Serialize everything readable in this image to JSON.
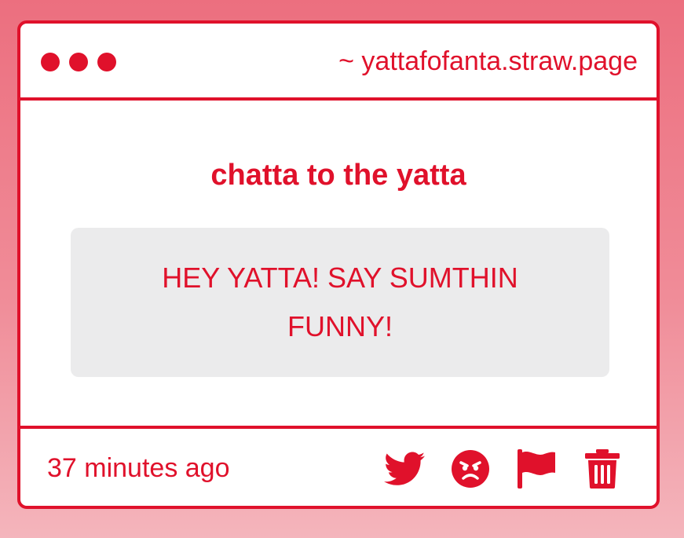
{
  "window": {
    "url": "~ yattafofanta.straw.page"
  },
  "main": {
    "heading": "chatta to the yatta",
    "message": "HEY YATTA! SAY SUMTHIN FUNNY!"
  },
  "footer": {
    "timestamp": "37 minutes ago",
    "actions": [
      {
        "icon": "twitter-icon"
      },
      {
        "icon": "angry-face-icon"
      },
      {
        "icon": "flag-icon"
      },
      {
        "icon": "trash-icon"
      }
    ]
  },
  "colors": {
    "accent": "#e0112b",
    "message_background": "#ebebec",
    "card_background": "#ffffff"
  }
}
